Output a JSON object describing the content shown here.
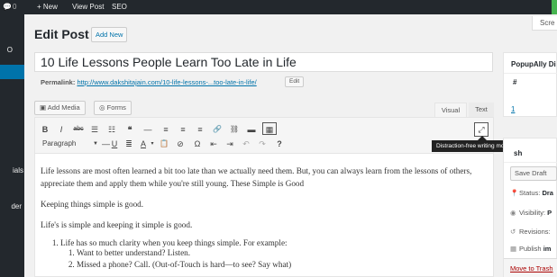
{
  "adminbar": {
    "comments_count": "0",
    "new_label": "+ New",
    "view_post_label": "View Post",
    "seo_label": "SEO"
  },
  "admin_menu": {
    "items": [
      "O",
      "",
      "ials",
      "der"
    ]
  },
  "screen_options": "Scre",
  "page": {
    "title": "Edit Post",
    "add_new_label": "Add New"
  },
  "post": {
    "title": "10 Life Lessons People Learn Too Late in Life",
    "permalink_label": "Permalink:",
    "permalink_url": "http://www.dakshitajain.com/10-life-lessons-...too-late-in-life/",
    "edit_label": "Edit"
  },
  "media_buttons": {
    "add_media": "Add Media",
    "forms": "Forms"
  },
  "editor_tabs": {
    "visual": "Visual",
    "text": "Text"
  },
  "toolbar": {
    "row1": [
      "B",
      "I",
      "abc",
      "☰",
      "☷",
      "❝",
      "—",
      "≡",
      "≡",
      "≡",
      "🔗",
      "⛓",
      "▬",
      "▦"
    ],
    "format_value": "Paragraph",
    "row2": [
      "—",
      "U",
      "≣",
      "A",
      "▾",
      "📋",
      "⊘",
      "Ω",
      "⇤",
      "⇥",
      "↶",
      "↷",
      "?"
    ]
  },
  "tooltip": "Distraction-free writing mode",
  "content": {
    "p1": "Life lessons are most often learned a bit too late than we actually need them. But, you can always learn from the lessons of others, appreciate them and apply them while you're still young. These Simple is Good",
    "p2": "Keeping things simple is good.",
    "p3": "Life's is simple and keeping it simple is good.",
    "li1": "Life has so much clarity when you keep things simple.  For example:",
    "li1a": "Want to better understand? Listen.",
    "li1b": "Missed a phone? Call. (Out-of-Touch is hard—to see? Say what)"
  },
  "popupally": {
    "heading": "PopupAlly Di",
    "col_hash": "#",
    "col_val": "",
    "row1": "1"
  },
  "publish": {
    "heading": "sh",
    "save_draft": "Save Draft",
    "status_label": "Status:",
    "status_value": "Dra",
    "visibility_label": "Visibility:",
    "visibility_value": "P",
    "revisions_label": "Revisions:",
    "publish_label": "Publish",
    "publish_value": "im",
    "trash": "Move to Trash"
  }
}
